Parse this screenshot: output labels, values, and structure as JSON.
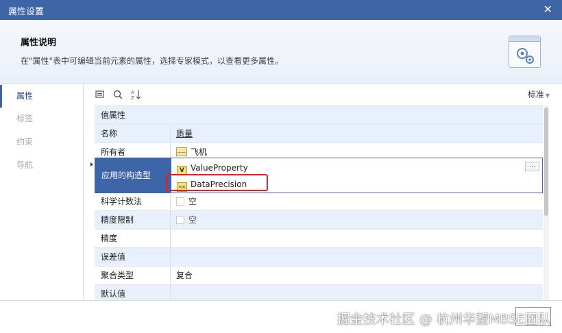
{
  "window": {
    "title": "属性设置"
  },
  "header": {
    "title": "属性说明",
    "description": "在\"属性\"表中可编辑当前元素的属性，选择专家模式，以查看更多属性。"
  },
  "nav": {
    "items": [
      {
        "label": "属性",
        "active": true
      },
      {
        "label": "标签",
        "active": false
      },
      {
        "label": "约束",
        "active": false
      },
      {
        "label": "导航",
        "active": false
      }
    ]
  },
  "toolbar": {
    "mode_select": "标准",
    "icons": [
      "list-view-icon",
      "search-icon",
      "sort-az-icon"
    ]
  },
  "grid": {
    "group_value": "值属性",
    "name_label": "名称",
    "name_value": "质量",
    "owner_label": "所有者",
    "owner_value": "飞机",
    "stereotype_label": "应用的构造型",
    "stereotype_1": "ValueProperty",
    "stereotype_1_badge": "V",
    "stereotype_2": "DataPrecision",
    "stereotype_2_badge": "«»",
    "ellipsis": "...",
    "sci_label": "科学计数法",
    "sci_value": "空",
    "limit_label": "精度限制",
    "limit_value": "空",
    "precision_label": "精度",
    "error_label": "误差值",
    "agg_label": "聚合类型",
    "agg_value": "复合",
    "partial_label": "默认值"
  },
  "footer": {
    "watermark": "掘金技术社区 @ 杭州华望MBSE团队"
  },
  "colors": {
    "titlebar": "#3e64a8",
    "selection": "#3e64a8",
    "alt_row": "#e8f0fb",
    "highlight_box": "#e0202a"
  }
}
